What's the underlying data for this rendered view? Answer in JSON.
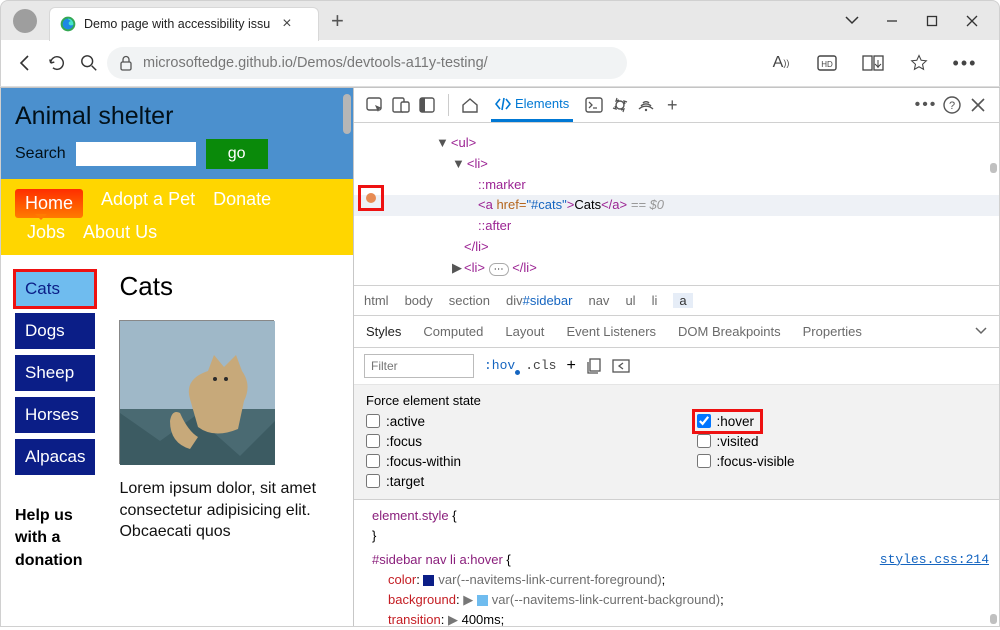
{
  "browser": {
    "tab_title": "Demo page with accessibility issu",
    "url": "microsoftedge.github.io/Demos/devtools-a11y-testing/"
  },
  "page": {
    "title": "Animal shelter",
    "search_label": "Search",
    "search_button": "go",
    "nav": {
      "home": "Home",
      "adopt": "Adopt a Pet",
      "donate": "Donate",
      "jobs": "Jobs",
      "about": "About Us"
    },
    "sidebar": [
      "Cats",
      "Dogs",
      "Sheep",
      "Horses",
      "Alpacas"
    ],
    "help_text": "Help us with a donation",
    "content_heading": "Cats",
    "content_text": "Lorem ipsum dolor, sit amet consectetur adipisicing elit. Obcaecati quos"
  },
  "devtools": {
    "tabs": {
      "elements": "Elements"
    },
    "dom": {
      "ul": "<ul>",
      "li_open": "<li>",
      "marker": "::marker",
      "a_open": "<a ",
      "href_attr": "href=",
      "href_val": "\"#cats\"",
      "a_close_open": ">",
      "link_text": "Cats",
      "a_close": "</a>",
      "eq": " == $0",
      "after": "::after",
      "li_close": "</li>",
      "li_collapsed_open": "<li>",
      "li_collapsed_dots": "⋯",
      "li_collapsed_close": "</li>"
    },
    "crumbs": [
      "html",
      "body",
      "section",
      "div#sidebar",
      "nav",
      "ul",
      "li",
      "a"
    ],
    "style_tabs": [
      "Styles",
      "Computed",
      "Layout",
      "Event Listeners",
      "DOM Breakpoints",
      "Properties"
    ],
    "toolbar": {
      "filter_placeholder": "Filter",
      "hov": ":hov",
      "cls": ".cls"
    },
    "force_state": {
      "title": "Force element state",
      "active": ":active",
      "hover": ":hover",
      "focus": ":focus",
      "visited": ":visited",
      "focus_within": ":focus-within",
      "focus_visible": ":focus-visible",
      "target": ":target"
    },
    "css": {
      "block1_sel": "element.style",
      "block2_sel": "#sidebar nav li a:hover",
      "link": "styles.css:214",
      "prop_color": "color",
      "var_fg": "--navitems-link-current-foreground",
      "prop_bg": "background",
      "var_bg": "--navitems-link-current-background",
      "prop_trans": "transition",
      "val_trans": "400ms"
    }
  }
}
